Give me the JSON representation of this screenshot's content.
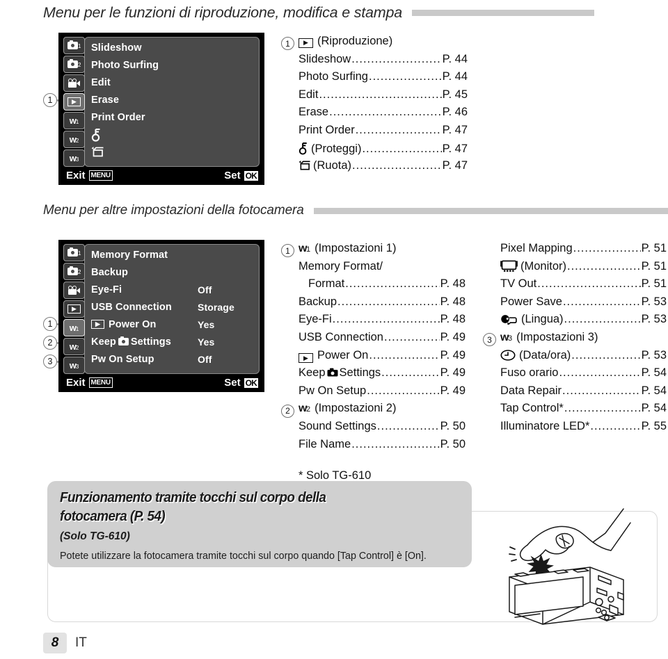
{
  "sections": [
    {
      "heading": "Menu per le funzioni di riproduzione, modifica e stampa",
      "callouts": [
        "1"
      ],
      "lcd": {
        "tabs": [
          {
            "icon": "camera-icon",
            "sub": "1",
            "selected": false
          },
          {
            "icon": "camera-icon",
            "sub": "2",
            "selected": false
          },
          {
            "icon": "movie-icon",
            "sub": "",
            "selected": false
          },
          {
            "icon": "playback-icon",
            "sub": "",
            "selected": true
          },
          {
            "icon": "wrench-icon",
            "sub": "1",
            "selected": false
          },
          {
            "icon": "wrench-icon",
            "sub": "2",
            "selected": false
          },
          {
            "icon": "wrench-icon",
            "sub": "3",
            "selected": false
          }
        ],
        "rows": [
          {
            "label": "Slideshow",
            "value": ""
          },
          {
            "label": "Photo Surfing",
            "value": ""
          },
          {
            "label": "Edit",
            "value": ""
          },
          {
            "label": "Erase",
            "value": ""
          },
          {
            "label": "Print Order",
            "value": ""
          },
          {
            "label": "",
            "icon": "protect-icon",
            "value": ""
          },
          {
            "label": "",
            "icon": "rotate-icon",
            "value": ""
          }
        ],
        "exit_label": "Exit",
        "exit_badge": "MENU",
        "set_label": "Set",
        "set_badge": "OK"
      },
      "toc": [
        {
          "num": "1",
          "group": "(Riproduzione)",
          "icon": "playback-icon"
        },
        {
          "name": "Slideshow",
          "page": "P. 44"
        },
        {
          "name": "Photo Surfing",
          "page": "P. 44"
        },
        {
          "name": "Edit",
          "page": "P. 45"
        },
        {
          "name": "Erase",
          "page": "P. 46"
        },
        {
          "name": "Print Order",
          "page": "P. 47"
        },
        {
          "name": "(Proteggi)",
          "icon": "protect-icon",
          "page": "P. 47"
        },
        {
          "name": "(Ruota)",
          "icon": "rotate-icon",
          "page": "P. 47"
        }
      ]
    },
    {
      "heading": "Menu per altre impostazioni della fotocamera",
      "callouts": [
        "1",
        "2",
        "3"
      ],
      "lcd": {
        "tabs": [
          {
            "icon": "camera-icon",
            "sub": "1",
            "selected": false
          },
          {
            "icon": "camera-icon",
            "sub": "2",
            "selected": false
          },
          {
            "icon": "movie-icon",
            "sub": "",
            "selected": false
          },
          {
            "icon": "playback-icon",
            "sub": "",
            "selected": false
          },
          {
            "icon": "wrench-icon",
            "sub": "1",
            "selected": true
          },
          {
            "icon": "wrench-icon",
            "sub": "2",
            "selected": false
          },
          {
            "icon": "wrench-icon",
            "sub": "3",
            "selected": false
          }
        ],
        "rows": [
          {
            "label": "Memory Format",
            "value": ""
          },
          {
            "label": "Backup",
            "value": ""
          },
          {
            "label": "Eye-Fi",
            "value": "Off"
          },
          {
            "label": "USB Connection",
            "value": "Storage"
          },
          {
            "label": "Power On",
            "icon": "playback-icon",
            "value": "Yes"
          },
          {
            "label_pre": "Keep",
            "label_post": "Settings",
            "icon": "camera-icon",
            "value": "Yes"
          },
          {
            "label": "Pw On Setup",
            "value": "Off"
          }
        ],
        "exit_label": "Exit",
        "exit_badge": "MENU",
        "set_label": "Set",
        "set_badge": "OK"
      },
      "toc_mid": [
        {
          "num": "1",
          "group": "(Impostazioni 1)",
          "icon": "wrench-icon",
          "sub": "1"
        },
        {
          "name": "Memory Format/",
          "page": ""
        },
        {
          "name": "Format",
          "page": "P. 48",
          "indent": true
        },
        {
          "name": "Backup",
          "page": "P. 48"
        },
        {
          "name": "Eye-Fi",
          "page": "P. 48"
        },
        {
          "name": "USB Connection",
          "page": "P. 49"
        },
        {
          "name": "Power On",
          "icon": "playback-icon",
          "page": "P. 49"
        },
        {
          "name_pre": "Keep",
          "name_post": "Settings",
          "icon": "camera-icon",
          "page": "P. 49"
        },
        {
          "name": "Pw On Setup",
          "page": "P. 49"
        },
        {
          "num": "2",
          "group": "(Impostazioni 2)",
          "icon": "wrench-icon",
          "sub": "2"
        },
        {
          "name": "Sound Settings",
          "page": "P. 50"
        },
        {
          "name": "File Name",
          "page": "P. 50"
        }
      ],
      "toc_note": "* Solo TG-610",
      "toc_right": [
        {
          "name": "Pixel Mapping",
          "page": "P. 51"
        },
        {
          "name": "(Monitor)",
          "icon": "monitor-icon",
          "page": "P. 51"
        },
        {
          "name": "TV Out",
          "page": "P. 51"
        },
        {
          "name": "Power Save",
          "page": "P. 53"
        },
        {
          "name": "(Lingua)",
          "icon": "language-icon",
          "page": "P. 53"
        },
        {
          "num": "3",
          "group": "(Impostazioni 3)",
          "icon": "wrench-icon",
          "sub": "3"
        },
        {
          "name": "(Data/ora)",
          "icon": "clock-icon",
          "page": "P. 53"
        },
        {
          "name": "Fuso orario",
          "page": "P. 54"
        },
        {
          "name": "Data Repair",
          "page": "P. 54"
        },
        {
          "name": "Tap Control*",
          "page": "P. 54"
        },
        {
          "name": "Illuminatore LED*",
          "page": "P. 55"
        }
      ]
    }
  ],
  "tip": {
    "title_line1": "Funzionamento tramite tocchi sul corpo della",
    "title_line2": "fotocamera (P. 54)",
    "subtitle": "(Solo TG-610)",
    "body": "Potete utilizzare la fotocamera tramite tocchi sul corpo quando [Tap Control] è [On]."
  },
  "footer": {
    "page_number": "8",
    "language_code": "IT"
  },
  "colors": {
    "rule": "#c9c9c9",
    "lcd_background": "#000000",
    "lcd_panel": "#4a4a4a",
    "tip_background": "#d0d0d0"
  }
}
